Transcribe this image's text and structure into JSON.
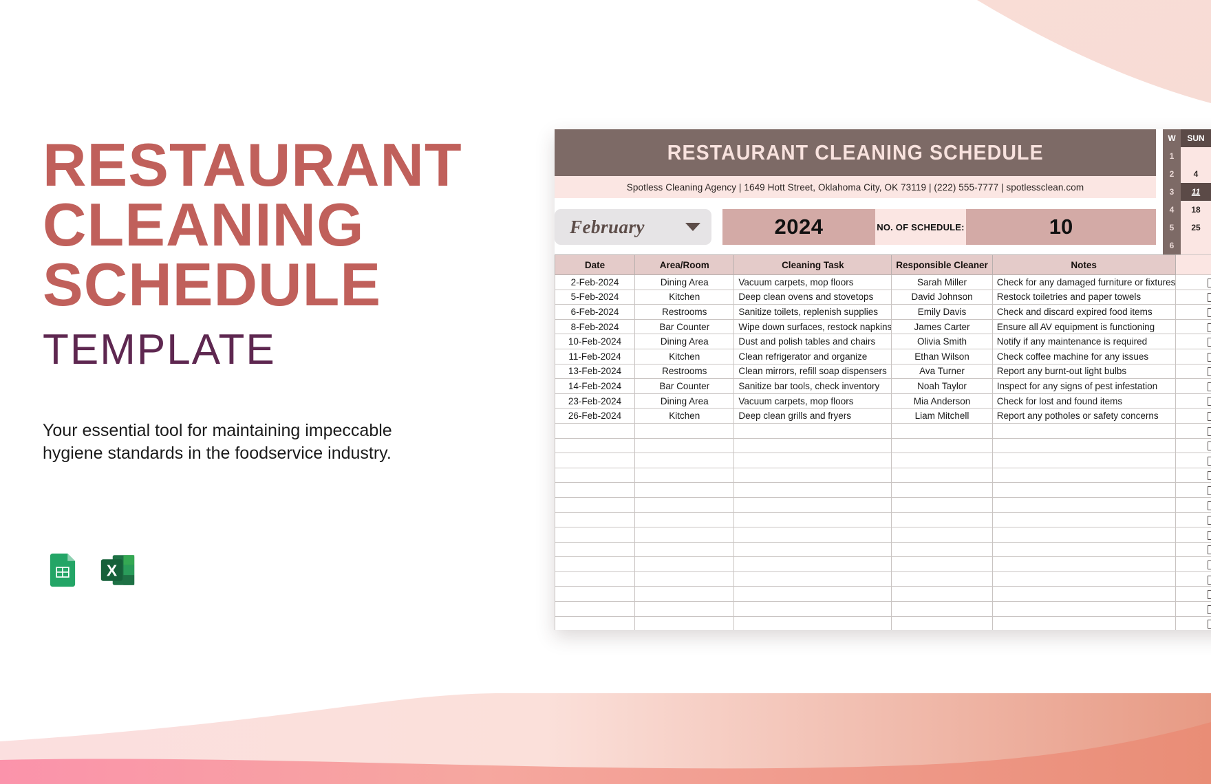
{
  "promo": {
    "title_lines": [
      "RESTAURANT",
      "CLEANING",
      "SCHEDULE"
    ],
    "subtitle": "TEMPLATE",
    "description": "Your essential tool for maintaining impeccable hygiene standards in the foodservice industry.",
    "title_color": "#c0605b",
    "subtitle_color": "#5e2750",
    "app_icons": [
      "google-sheets-icon",
      "microsoft-excel-icon"
    ]
  },
  "sheet": {
    "title": "RESTAURANT CLEANING SCHEDULE",
    "contact": "Spotless Cleaning Agency | 1649 Hott Street, Oklahoma City, OK 73119 | (222) 555-7777 | spotlessclean.com",
    "controls": {
      "month": "February",
      "month_caret": "chevron-down-icon",
      "year": "2024",
      "schedule_count_label": "NO. OF SCHEDULE:",
      "schedule_count_value": "10"
    },
    "table": {
      "headers": [
        "Date",
        "Area/Room",
        "Cleaning Task",
        "Responsible Cleaner",
        "Notes",
        ""
      ],
      "rows": [
        {
          "date": "2-Feb-2024",
          "area": "Dining Area",
          "task": "Vacuum carpets, mop floors",
          "cleaner": "Sarah Miller",
          "notes": "Check for any damaged furniture or fixtures"
        },
        {
          "date": "5-Feb-2024",
          "area": "Kitchen",
          "task": "Deep clean ovens and stovetops",
          "cleaner": "David Johnson",
          "notes": "Restock toiletries and paper towels"
        },
        {
          "date": "6-Feb-2024",
          "area": "Restrooms",
          "task": "Sanitize toilets, replenish supplies",
          "cleaner": "Emily Davis",
          "notes": "Check and discard expired food items"
        },
        {
          "date": "8-Feb-2024",
          "area": "Bar Counter",
          "task": "Wipe down surfaces, restock napkins",
          "cleaner": "James Carter",
          "notes": "Ensure all AV equipment is functioning"
        },
        {
          "date": "10-Feb-2024",
          "area": "Dining Area",
          "task": "Dust and polish tables and chairs",
          "cleaner": "Olivia Smith",
          "notes": "Notify if any maintenance is required"
        },
        {
          "date": "11-Feb-2024",
          "area": "Kitchen",
          "task": "Clean refrigerator and organize",
          "cleaner": "Ethan Wilson",
          "notes": "Check coffee machine for any issues"
        },
        {
          "date": "13-Feb-2024",
          "area": "Restrooms",
          "task": "Clean mirrors, refill soap dispensers",
          "cleaner": "Ava Turner",
          "notes": "Report any burnt-out light bulbs"
        },
        {
          "date": "14-Feb-2024",
          "area": "Bar Counter",
          "task": "Sanitize bar tools, check inventory",
          "cleaner": "Noah Taylor",
          "notes": "Inspect for any signs of pest infestation"
        },
        {
          "date": "23-Feb-2024",
          "area": "Dining Area",
          "task": "Vacuum carpets, mop floors",
          "cleaner": "Mia Anderson",
          "notes": "Check for lost and found items"
        },
        {
          "date": "26-Feb-2024",
          "area": "Kitchen",
          "task": "Deep clean grills and fryers",
          "cleaner": "Liam Mitchell",
          "notes": "Report any potholes or safety concerns"
        },
        {
          "date": "",
          "area": "",
          "task": "",
          "cleaner": "",
          "notes": ""
        },
        {
          "date": "",
          "area": "",
          "task": "",
          "cleaner": "",
          "notes": ""
        },
        {
          "date": "",
          "area": "",
          "task": "",
          "cleaner": "",
          "notes": ""
        },
        {
          "date": "",
          "area": "",
          "task": "",
          "cleaner": "",
          "notes": ""
        },
        {
          "date": "",
          "area": "",
          "task": "",
          "cleaner": "",
          "notes": ""
        },
        {
          "date": "",
          "area": "",
          "task": "",
          "cleaner": "",
          "notes": ""
        },
        {
          "date": "",
          "area": "",
          "task": "",
          "cleaner": "",
          "notes": ""
        },
        {
          "date": "",
          "area": "",
          "task": "",
          "cleaner": "",
          "notes": ""
        },
        {
          "date": "",
          "area": "",
          "task": "",
          "cleaner": "",
          "notes": ""
        },
        {
          "date": "",
          "area": "",
          "task": "",
          "cleaner": "",
          "notes": ""
        },
        {
          "date": "",
          "area": "",
          "task": "",
          "cleaner": "",
          "notes": ""
        },
        {
          "date": "",
          "area": "",
          "task": "",
          "cleaner": "",
          "notes": ""
        },
        {
          "date": "",
          "area": "",
          "task": "",
          "cleaner": "",
          "notes": ""
        },
        {
          "date": "",
          "area": "",
          "task": "",
          "cleaner": "",
          "notes": ""
        },
        {
          "date": "",
          "area": "",
          "task": "",
          "cleaner": "",
          "notes": ""
        }
      ]
    }
  },
  "calendar": {
    "week_header": "W",
    "sun_header": "SUN",
    "week_numbers": [
      "1",
      "2",
      "3",
      "4",
      "5",
      "6"
    ],
    "sun_dates": [
      "",
      "4",
      "11",
      "18",
      "25",
      ""
    ],
    "highlighted_index": 2
  },
  "colors": {
    "header_brown": "#7d6a66",
    "band_pink": "#fbe6e3",
    "accent_mauve": "#d3aaa6",
    "table_header": "#e4cbc9",
    "title_red": "#c0605b",
    "subtitle_purple": "#5e2750"
  }
}
